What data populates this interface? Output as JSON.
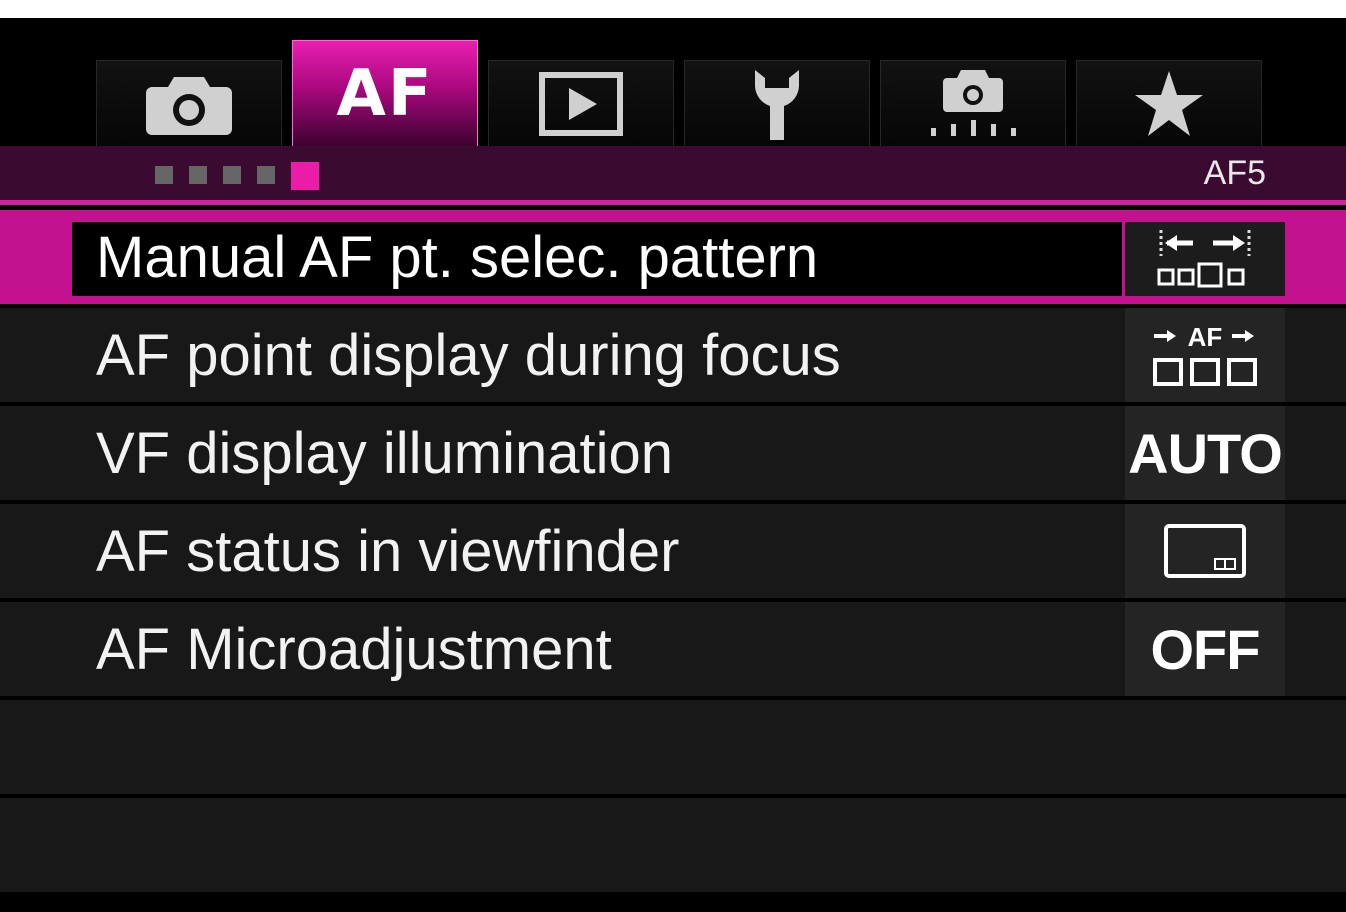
{
  "tabs": [
    {
      "id": "shooting",
      "icon": "camera-icon",
      "label": "",
      "active": false
    },
    {
      "id": "af",
      "icon": "",
      "label": "AF",
      "active": true
    },
    {
      "id": "playback",
      "icon": "playback-icon",
      "label": "",
      "active": false
    },
    {
      "id": "setup",
      "icon": "wrench-icon",
      "label": "",
      "active": false
    },
    {
      "id": "custom",
      "icon": "custom-functions-icon",
      "label": "",
      "active": false
    },
    {
      "id": "mymenu",
      "icon": "star-icon",
      "label": "",
      "active": false
    }
  ],
  "page_indicator": {
    "total": 5,
    "current": 5,
    "code": "AF5"
  },
  "menu_items": [
    {
      "label": "Manual AF pt. selec. pattern",
      "value_icon": "af-point-selection-pattern-icon",
      "value_text": "",
      "selected": true
    },
    {
      "label": "AF point display during focus",
      "value_icon": "af-point-display-icon",
      "value_text": "",
      "selected": false
    },
    {
      "label": "VF display illumination",
      "value_icon": "",
      "value_text": "AUTO",
      "selected": false
    },
    {
      "label": "AF status in viewfinder",
      "value_icon": "viewfinder-status-icon",
      "value_text": "",
      "selected": false
    },
    {
      "label": "AF Microadjustment",
      "value_icon": "",
      "value_text": "OFF",
      "selected": false
    }
  ],
  "colors": {
    "accent": "#c3128f",
    "page_bar": "#3a0a30",
    "row_bg": "#181818",
    "background": "#000000"
  }
}
